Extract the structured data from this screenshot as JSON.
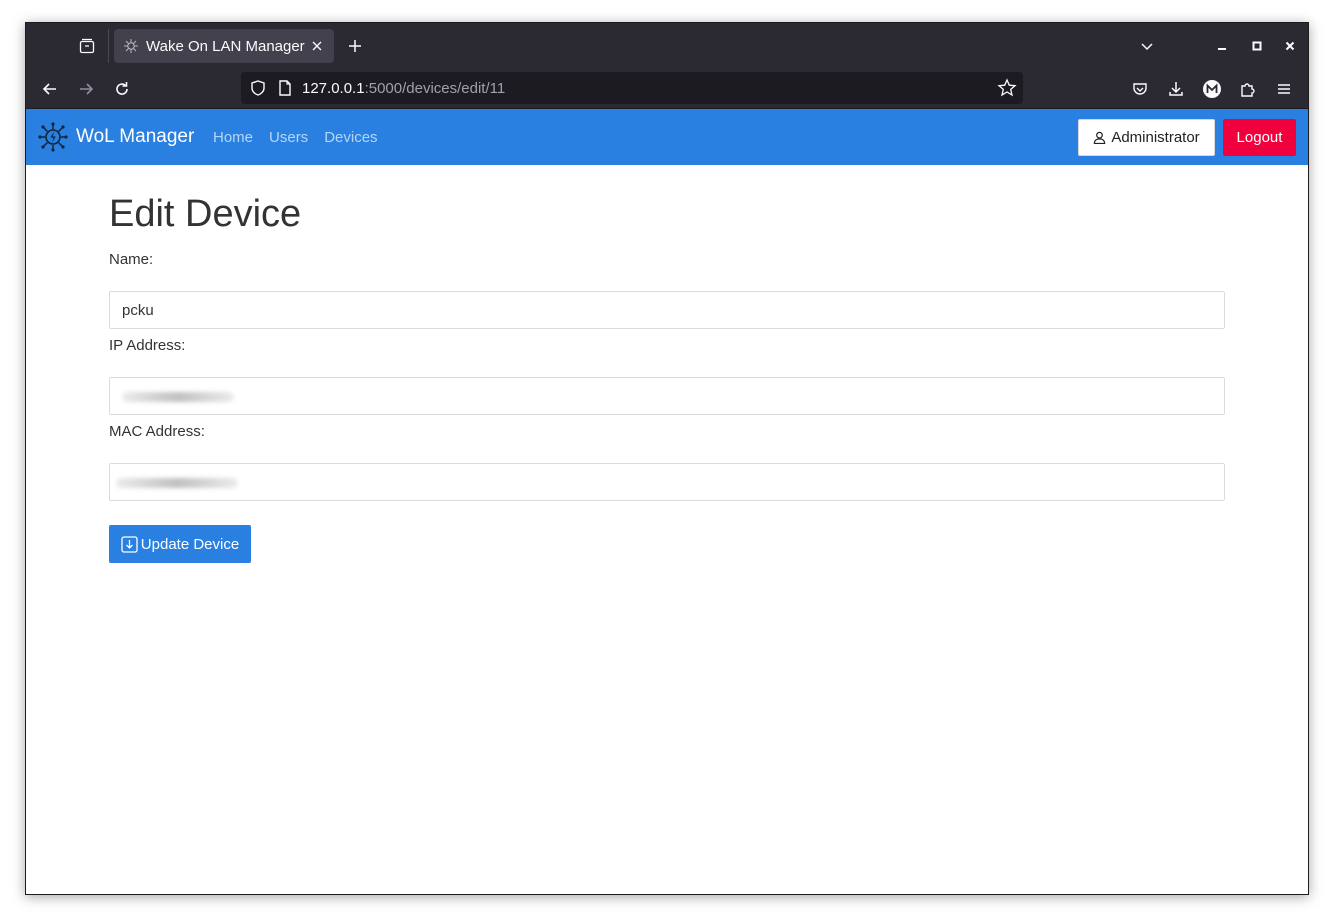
{
  "browser": {
    "tab_title": "Wake On LAN Manager",
    "url_host": "127.0.0.1",
    "url_path": ":5000/devices/edit/11"
  },
  "app": {
    "brand": "WoL Manager",
    "nav_links": [
      "Home",
      "Users",
      "Devices"
    ],
    "user_button": "Administrator",
    "logout_button": "Logout",
    "accent_color": "#2980e0",
    "logout_color": "#f0003c"
  },
  "form": {
    "title": "Edit Device",
    "name_label": "Name:",
    "name_value": "pcku",
    "ip_label": "IP Address:",
    "mac_label": "MAC Address:",
    "submit_label": "Update Device"
  }
}
